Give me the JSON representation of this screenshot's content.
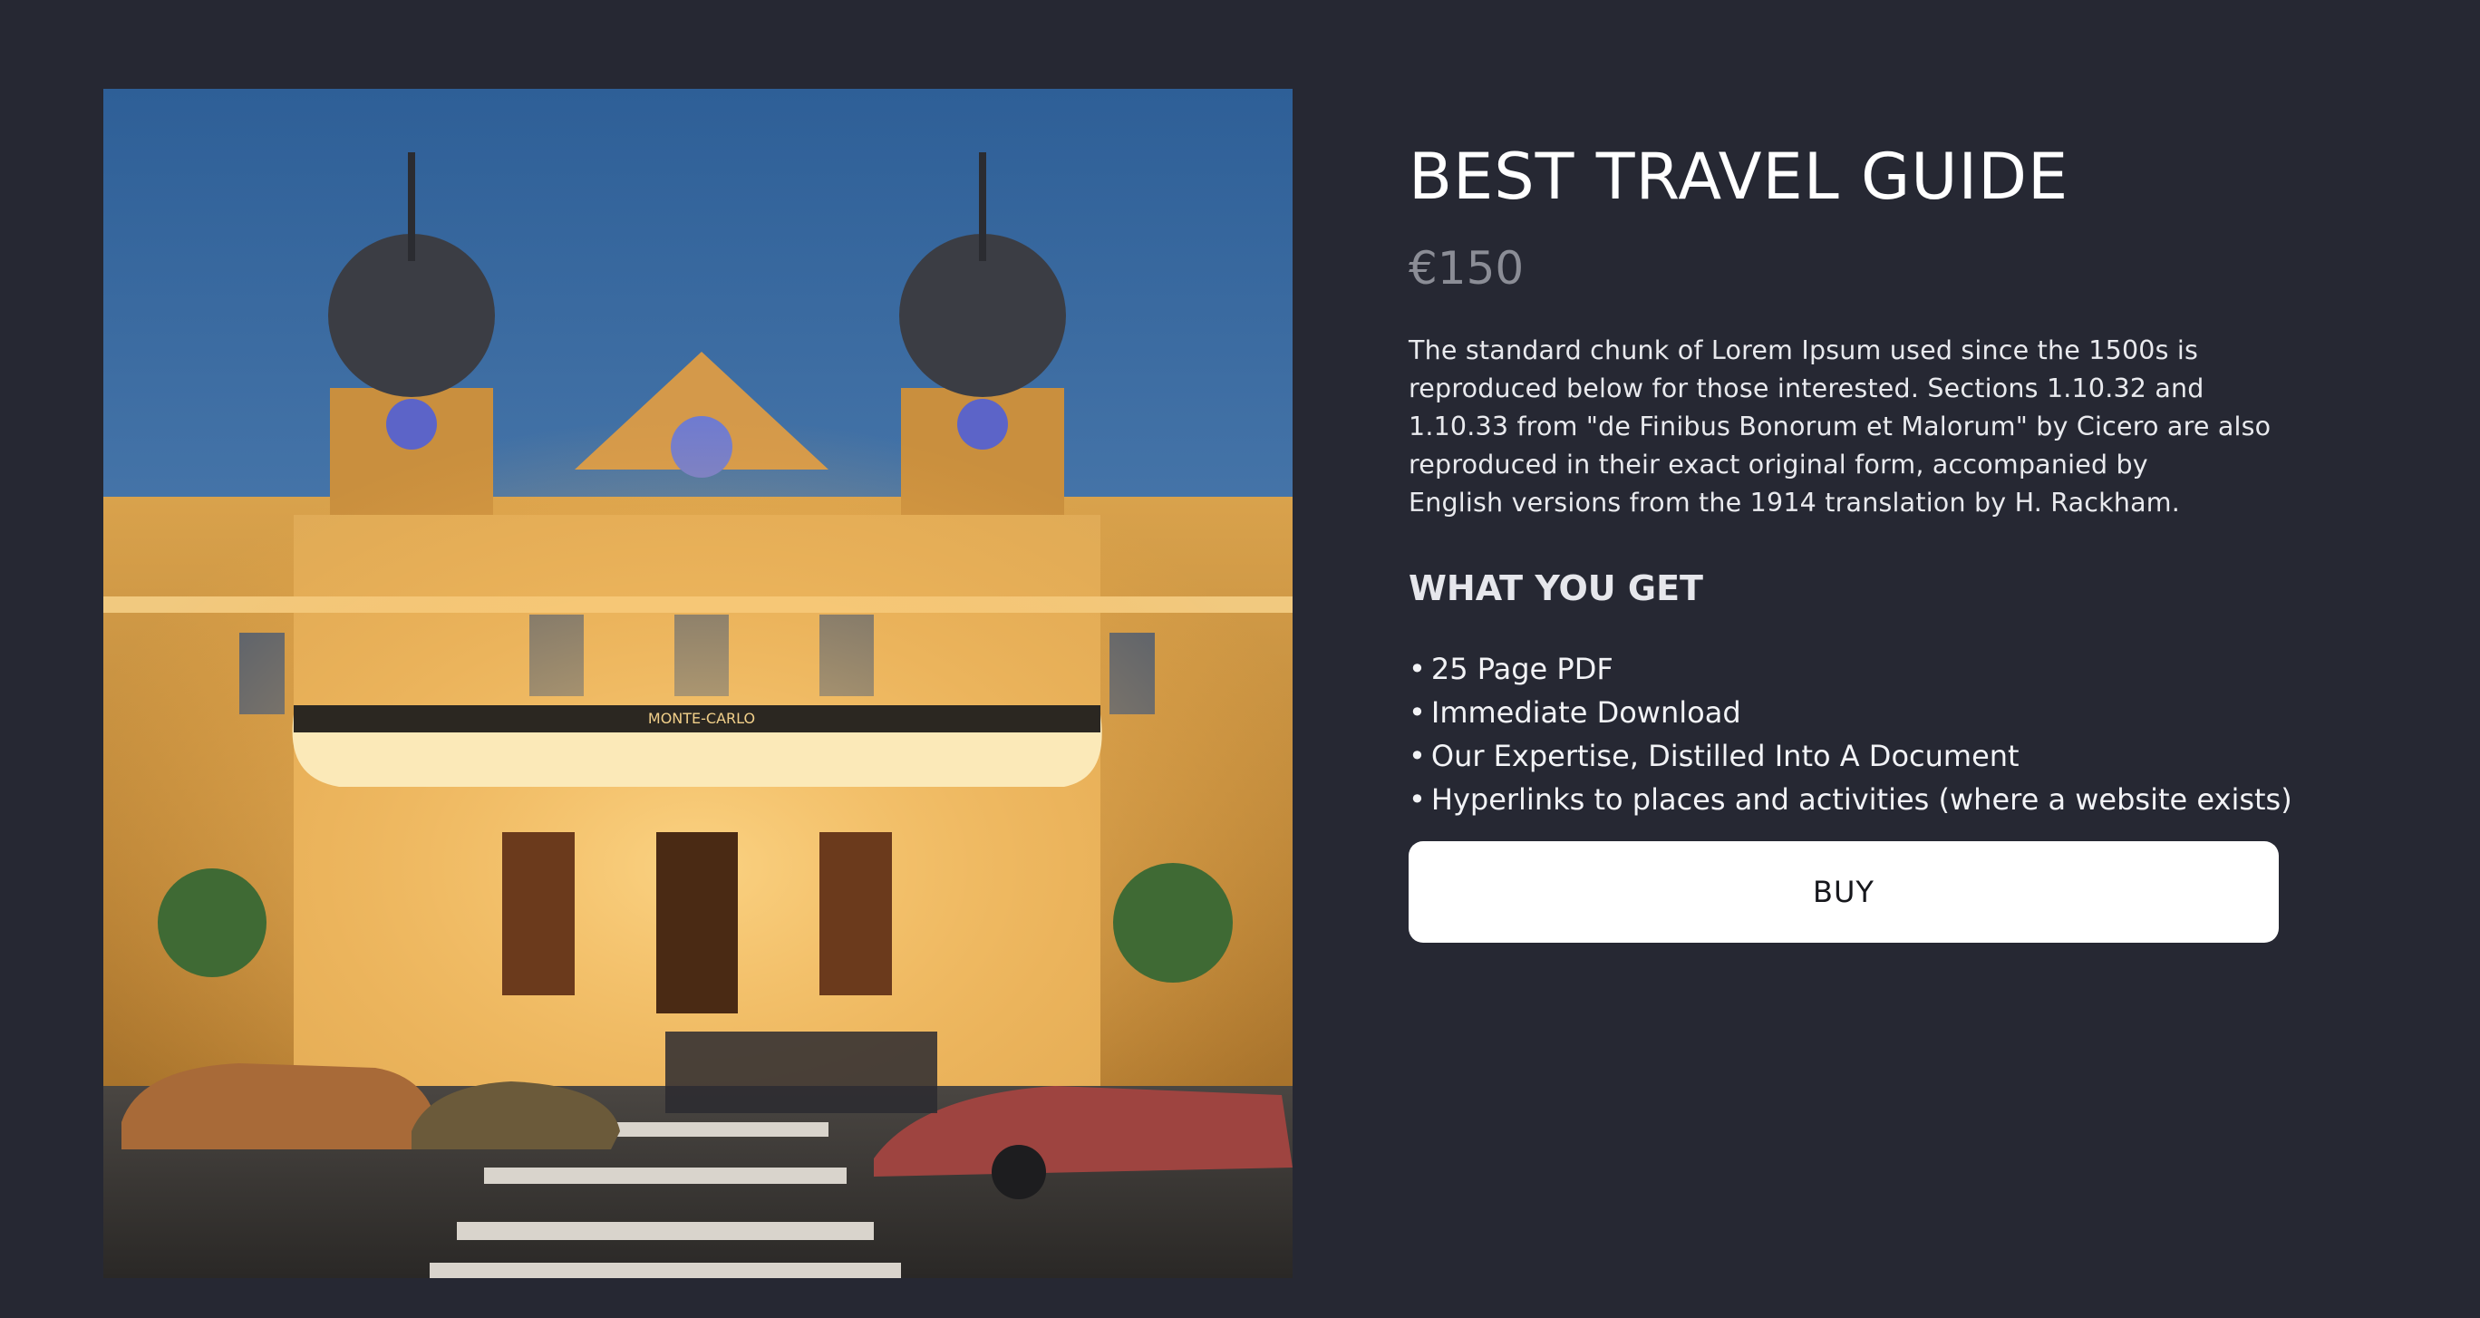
{
  "product": {
    "title": "BEST TRAVEL GUIDE",
    "price": "€150",
    "description_lines": [
      "The standard chunk of Lorem Ipsum used since the 1500s is",
      "reproduced below for those interested. Sections 1.10.32 and",
      "1.10.33 from \"de Finibus Bonorum et Malorum\" by Cicero are also",
      "reproduced in their exact original form, accompanied by",
      "English versions from the 1914 translation by H. Rackham."
    ],
    "subheading": "WHAT YOU GET",
    "bullet": "•",
    "benefits": [
      "25 Page PDF",
      "Immediate Download",
      "Our Expertise, Distilled Into A Document",
      "Hyperlinks to places and activities (where a website exists)"
    ],
    "buy_label": "BUY"
  },
  "image": {
    "subject": "illustrated-grand-casino-facade-at-dusk",
    "sign_text": "MONTE-CARLO"
  },
  "colors": {
    "background": "#262833",
    "title": "#ffffff",
    "price": "#8b8d96",
    "button_bg": "#ffffff",
    "button_text": "#16171c"
  }
}
